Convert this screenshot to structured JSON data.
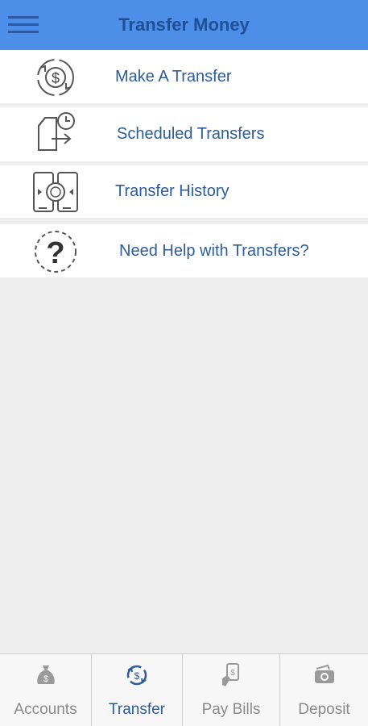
{
  "header": {
    "title": "Transfer Money",
    "menu_icon": "hamburger-icon"
  },
  "menu": {
    "items": [
      {
        "label": "Make A Transfer",
        "icon": "dollar-cycle-icon"
      },
      {
        "label": "Scheduled Transfers",
        "icon": "clock-document-icon"
      },
      {
        "label": "Transfer History",
        "icon": "device-transfer-icon"
      },
      {
        "label": "Need Help with Transfers?",
        "icon": "question-icon"
      }
    ]
  },
  "tabbar": {
    "tabs": [
      {
        "label": "Accounts",
        "icon": "money-bag-icon",
        "active": false
      },
      {
        "label": "Transfer",
        "icon": "transfer-cycle-icon",
        "active": true
      },
      {
        "label": "Pay Bills",
        "icon": "bill-payment-icon",
        "active": false
      },
      {
        "label": "Deposit",
        "icon": "camera-icon",
        "active": false
      }
    ]
  },
  "colors": {
    "header_bg": "#4d8fe8",
    "title": "#1f4f96",
    "link_text": "#2c5c99",
    "inactive_tab": "#8a8a8a",
    "icon_gray": "#555555"
  }
}
